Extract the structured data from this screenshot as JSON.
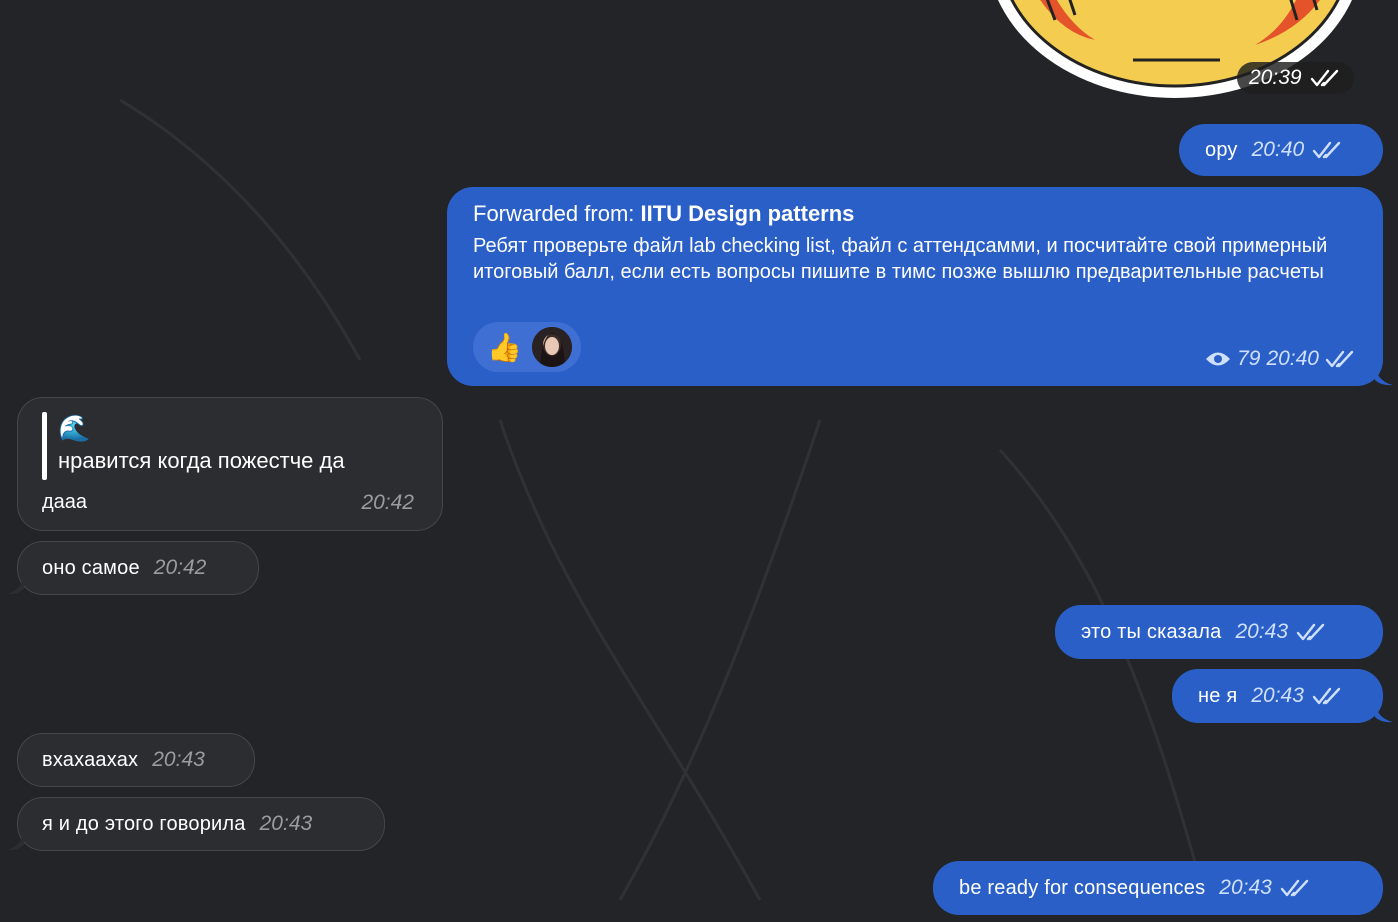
{
  "sticker": {
    "time": "20:39"
  },
  "messages": {
    "m1": {
      "text": "ору",
      "time": "20:40"
    },
    "forward": {
      "from_label": "Forwarded from: ",
      "from_name": "IITU Design patterns",
      "body": "Ребят проверьте файл lab checking list, файл с аттендсамми, и посчитайте свой примерный итоговый балл, если есть вопросы пишите в тимс позже вышлю предварительные расчеты",
      "reaction_emoji": "👍",
      "views": "79",
      "time": "20:40"
    },
    "reply": {
      "quoted_emoji": "🌊",
      "quoted_text": "нравится когда пожестче да",
      "text": "дааа",
      "time": "20:42"
    },
    "m3": {
      "text": "оно самое",
      "time": "20:42"
    },
    "m4": {
      "text": "это ты сказала",
      "time": "20:43"
    },
    "m5": {
      "text": "не я",
      "time": "20:43"
    },
    "m6": {
      "text": "вхахаахах",
      "time": "20:43"
    },
    "m7": {
      "text": "я и до этого говорила",
      "time": "20:43"
    },
    "m8": {
      "text": "be ready for consequences",
      "time": "20:43"
    }
  }
}
